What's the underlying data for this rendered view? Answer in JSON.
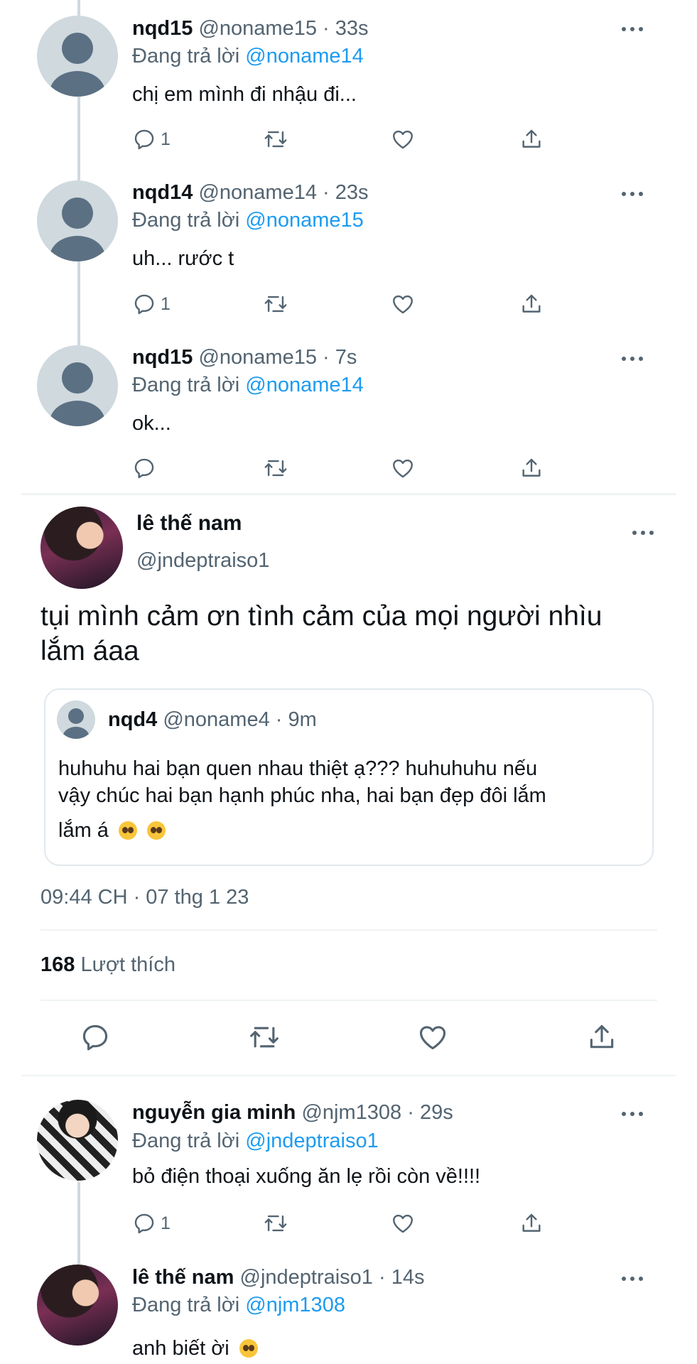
{
  "thread_replies": [
    {
      "name": "nqd15",
      "handle": "@noname15",
      "time": "33s",
      "replying_prefix": "Đang trả lời",
      "replying_to": "@noname14",
      "text": "chị em mình đi nhậu đi...",
      "reply_count": "1"
    },
    {
      "name": "nqd14",
      "handle": "@noname14",
      "time": "23s",
      "replying_prefix": "Đang trả lời",
      "replying_to": "@noname15",
      "text": "uh... rước t",
      "reply_count": "1"
    },
    {
      "name": "nqd15",
      "handle": "@noname15",
      "time": "7s",
      "replying_prefix": "Đang trả lời",
      "replying_to": "@noname14",
      "text": "ok...",
      "reply_count": ""
    }
  ],
  "main_tweet": {
    "name": "lê thế nam",
    "handle": "@jndeptraiso1",
    "text_line1": "tụi mình cảm ơn tình cảm của mọi người nhìu",
    "text_line2": "lắm áaa",
    "quote": {
      "name": "nqd4",
      "handle": "@noname4",
      "time": "9m",
      "line1": "huhuhu hai bạn quen nhau thiệt ạ??? huhuhuhu nếu",
      "line2": "vậy chúc hai bạn hạnh phúc nha, hai bạn đẹp đôi lắm",
      "line3": "lắm á"
    },
    "timestamp": "09:44 CH · 07 thg 1 23",
    "likes_count": "168",
    "likes_label": "Lượt thích"
  },
  "replies": [
    {
      "name": "nguyễn gia minh",
      "handle": "@njm1308",
      "time": "29s",
      "replying_prefix": "Đang trả lời",
      "replying_to": "@jndeptraiso1",
      "text": "bỏ điện thoại xuống ăn lẹ rồi còn về!!!!",
      "reply_count": "1"
    },
    {
      "name": "lê thế nam",
      "handle": "@jndeptraiso1",
      "time": "14s",
      "replying_prefix": "Đang trả lời",
      "replying_to": "@njm1308",
      "text": "anh biết ời"
    }
  ],
  "separator": " · ",
  "icons": {
    "reply": "reply-icon",
    "retweet": "retweet-icon",
    "like": "like-icon",
    "share": "share-icon",
    "more": "more-icon",
    "emoji": "pleading-face-emoji"
  },
  "colors": {
    "accent": "#1d9bf0",
    "secondary_text": "#536471",
    "primary_text": "#0f1419",
    "divider": "#eff3f4"
  }
}
